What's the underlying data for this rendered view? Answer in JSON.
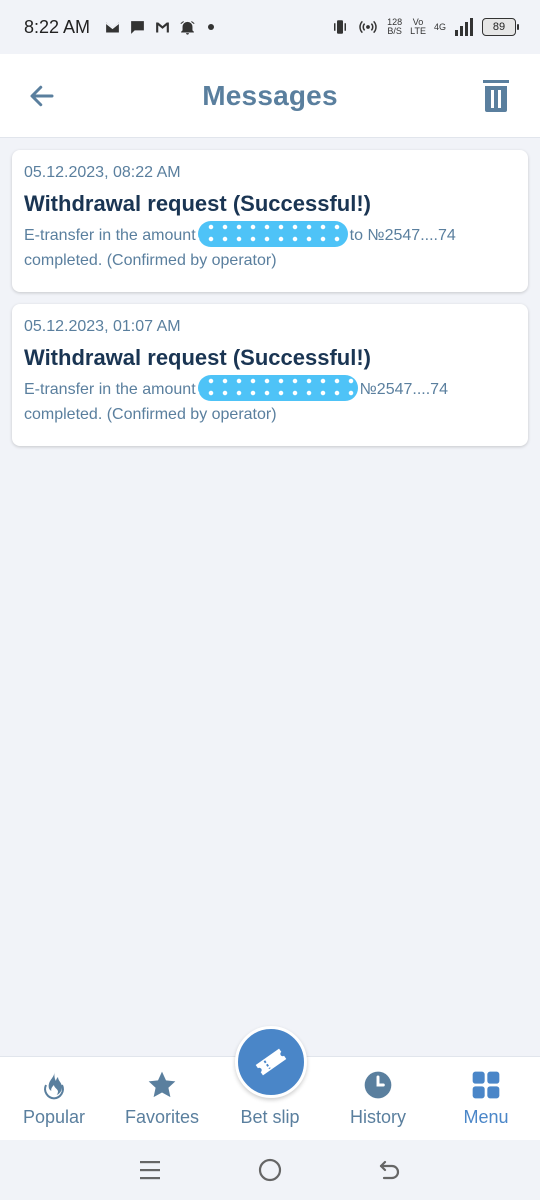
{
  "status_bar": {
    "time": "8:22 AM",
    "speed_value": "128",
    "speed_unit": "B/S",
    "vo": "Vo",
    "lte": "LTE",
    "net": "4G",
    "battery": "89"
  },
  "header": {
    "title": "Messages"
  },
  "messages": [
    {
      "date": "05.12.2023, 08:22 AM",
      "title": "Withdrawal request (Successful!)",
      "body_before": "E-transfer in the amount",
      "body_after": "to №2547....74",
      "body_line2": "completed. (Confirmed by operator)"
    },
    {
      "date": "05.12.2023, 01:07 AM",
      "title": "Withdrawal request (Successful!)",
      "body_before": "E-transfer in the amount",
      "body_after": "№2547....74",
      "body_line2": "completed. (Confirmed by operator)"
    }
  ],
  "bottom_nav": {
    "items": [
      {
        "label": "Popular",
        "icon": "flame-icon"
      },
      {
        "label": "Favorites",
        "icon": "star-icon"
      },
      {
        "label": "Bet slip",
        "icon": "ticket-icon"
      },
      {
        "label": "History",
        "icon": "clock-icon"
      },
      {
        "label": "Menu",
        "icon": "grid-icon"
      }
    ]
  },
  "colors": {
    "accent": "#4a86c8",
    "muted": "#5a7f9e",
    "title_text": "#1a3553",
    "background": "#f1f3f8"
  }
}
